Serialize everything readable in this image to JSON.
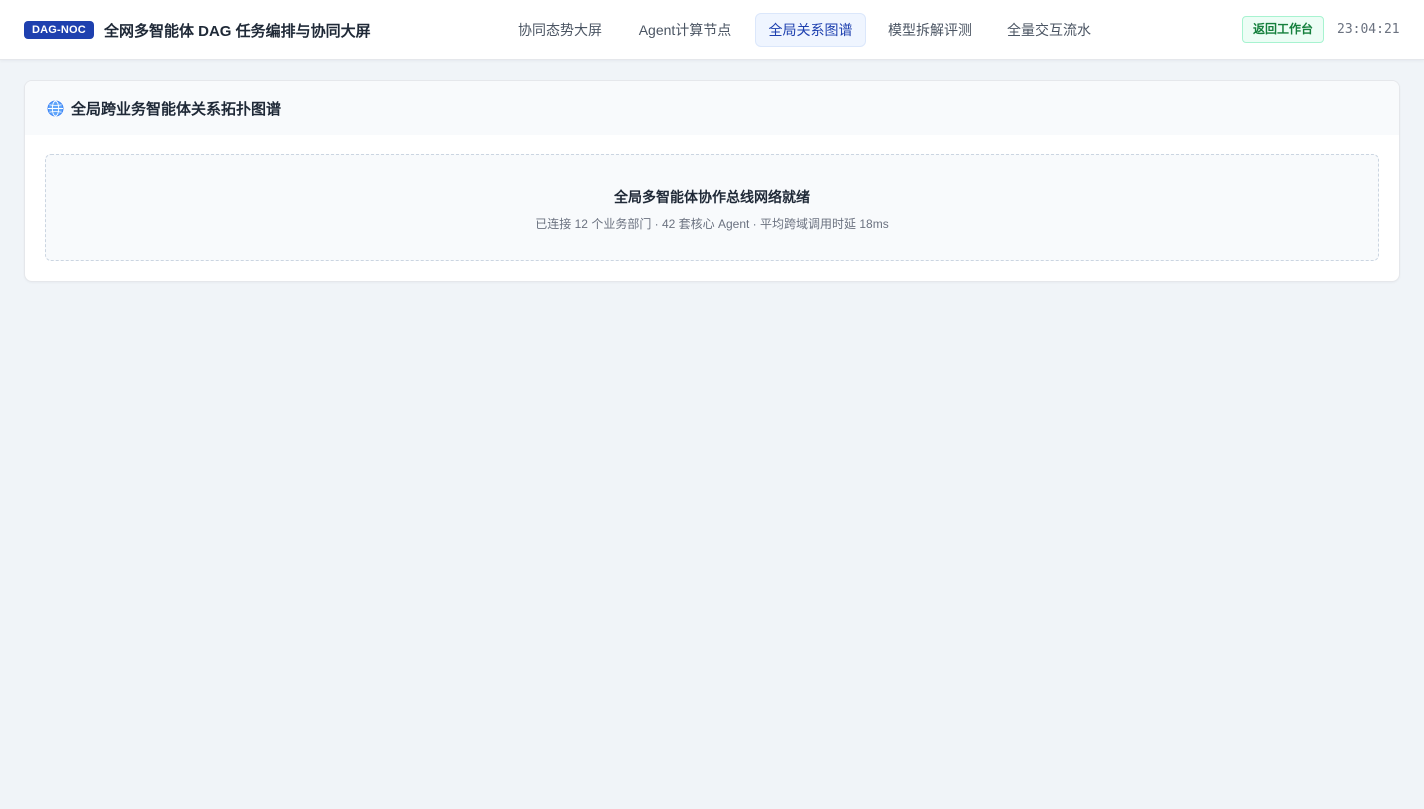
{
  "header": {
    "badge": "DAG-NOC",
    "title": "全网多智能体 DAG 任务编排与协同大屏",
    "nav": [
      {
        "label": "协同态势大屏",
        "active": false
      },
      {
        "label": "Agent计算节点",
        "active": false
      },
      {
        "label": "全局关系图谱",
        "active": true
      },
      {
        "label": "模型拆解评测",
        "active": false
      },
      {
        "label": "全量交互流水",
        "active": false
      }
    ],
    "return_label": "返回工作台",
    "clock": "23:04:21"
  },
  "panel": {
    "icon": "globe-icon",
    "title": "全局跨业务智能体关系拓扑图谱",
    "status_title": "全局多智能体协作总线网络就绪",
    "status_subtitle": "已连接 12 个业务部门 · 42 套核心 Agent · 平均跨域调用时延 18ms"
  },
  "colors": {
    "brand": "#1e40af",
    "active_nav_bg": "#eff5ff",
    "return_green": "#15803d",
    "page_bg": "#f0f4f8"
  }
}
